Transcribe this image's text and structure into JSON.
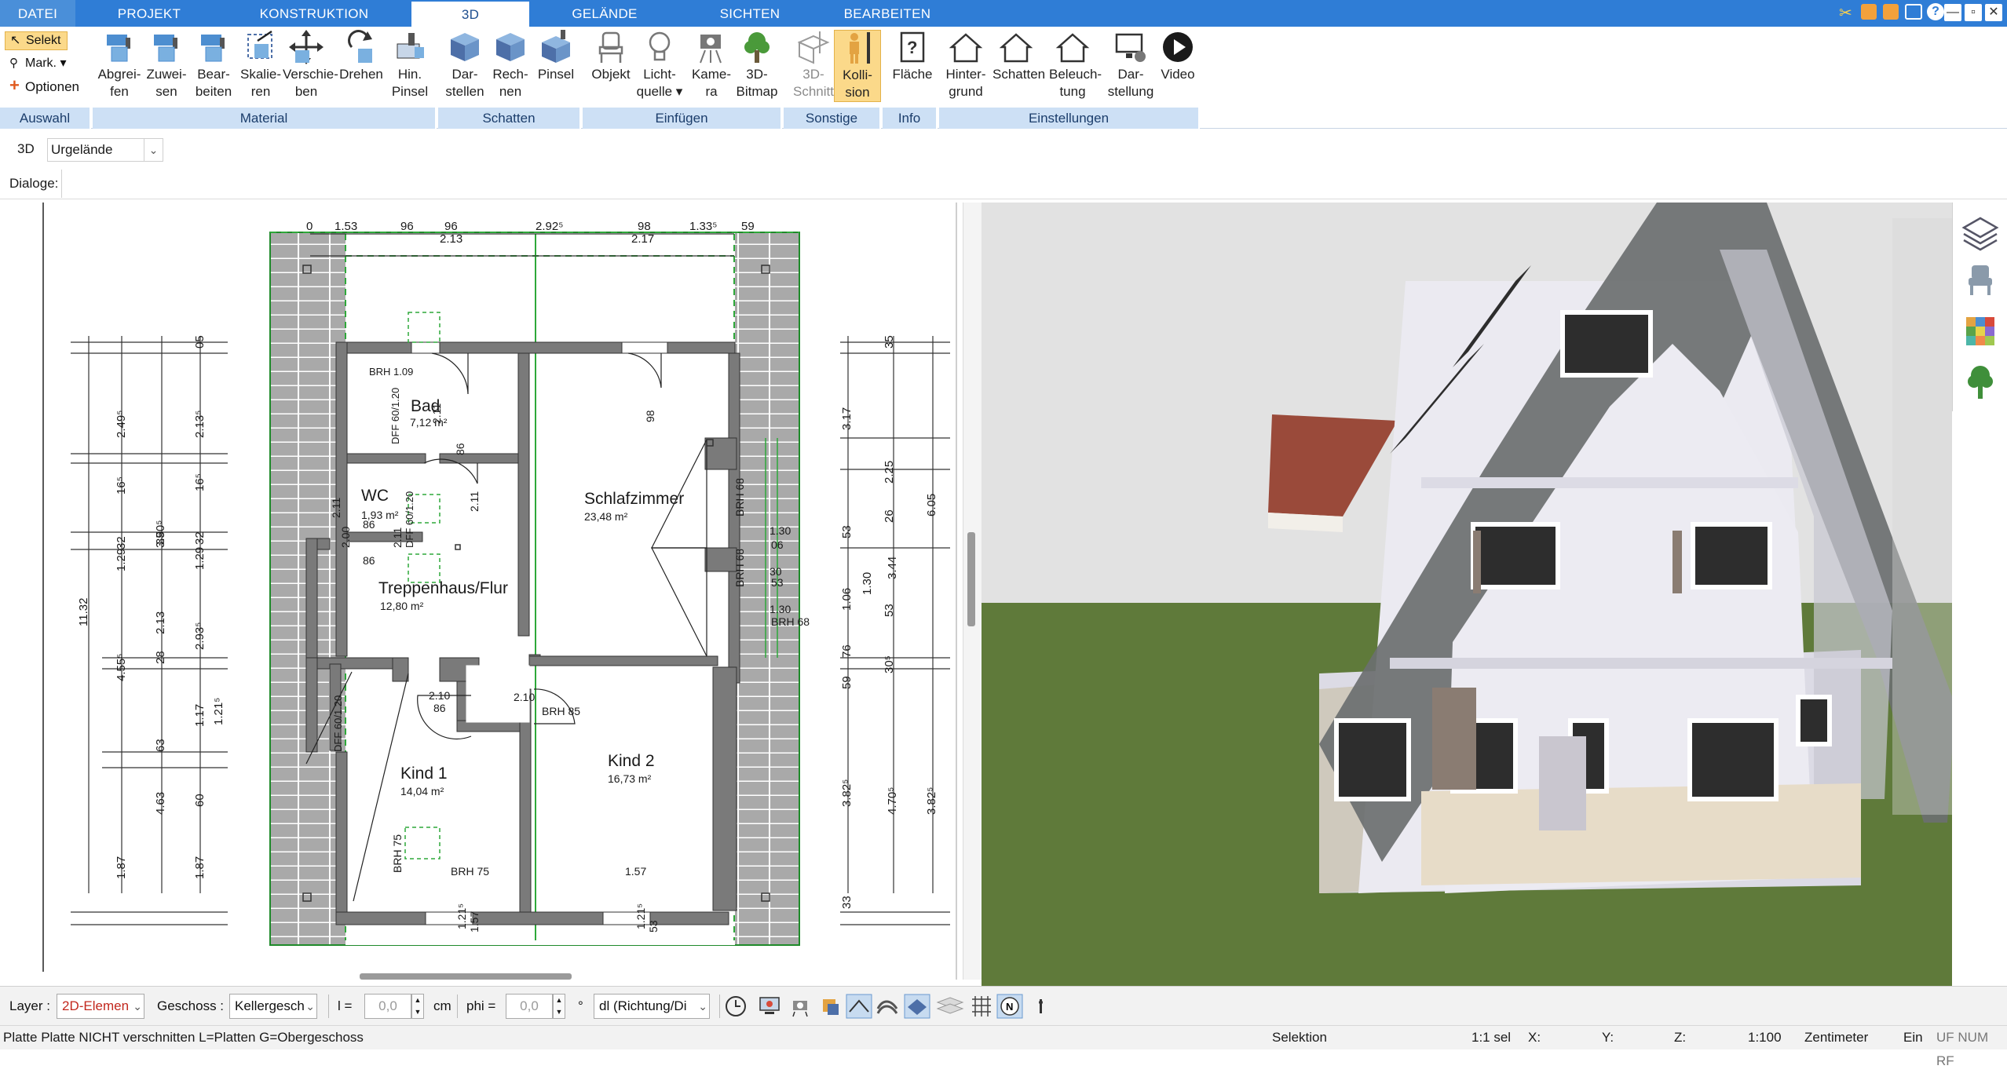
{
  "tabs": [
    "DATEI",
    "PROJEKT",
    "KONSTRUKTION",
    "3D",
    "GELÄNDE",
    "SICHTEN",
    "BEARBEITEN"
  ],
  "window_controls": [
    "—",
    "▫",
    "✕"
  ],
  "selection": {
    "select": "Selekt",
    "mark": "Mark.",
    "options": "Optionen"
  },
  "ribbon": {
    "buttons": [
      {
        "l1": "Abgrei-",
        "l2": "fen",
        "icon": "paint-roller-icon"
      },
      {
        "l1": "Zuwei-",
        "l2": "sen",
        "icon": "paint-roller-icon"
      },
      {
        "l1": "Bear-",
        "l2": "beiten",
        "icon": "paint-roller-icon"
      },
      {
        "l1": "Skalie-",
        "l2": "ren",
        "icon": "scale-icon"
      },
      {
        "l1": "Verschie-",
        "l2": "ben",
        "icon": "move-icon"
      },
      {
        "l1": "Drehen",
        "l2": "",
        "icon": "rotate-icon"
      },
      {
        "l1": "Hin.",
        "l2": "Pinsel",
        "icon": "brush-icon"
      },
      {
        "l1": "Dar-",
        "l2": "stellen",
        "icon": "cube-icon"
      },
      {
        "l1": "Rech-",
        "l2": "nen",
        "icon": "cube-icon"
      },
      {
        "l1": "Pinsel",
        "l2": "",
        "icon": "cube-brush-icon"
      },
      {
        "l1": "Objekt",
        "l2": "",
        "icon": "chair-icon"
      },
      {
        "l1": "Licht-",
        "l2": "quelle ▾",
        "icon": "lightbulb-icon"
      },
      {
        "l1": "Kame-",
        "l2": "ra",
        "icon": "camera-icon"
      },
      {
        "l1": "3D-",
        "l2": "Bitmap",
        "icon": "tree-icon"
      },
      {
        "l1": "3D-",
        "l2": "Schnitt",
        "icon": "section-cube-icon"
      },
      {
        "l1": "Kolli-",
        "l2": "sion",
        "icon": "person-collision-icon"
      },
      {
        "l1": "Fläche",
        "l2": "",
        "icon": "area-info-icon"
      },
      {
        "l1": "Hinter-",
        "l2": "grund",
        "icon": "house-icon"
      },
      {
        "l1": "Schatten",
        "l2": "",
        "icon": "house-icon"
      },
      {
        "l1": "Beleuch-",
        "l2": "tung",
        "icon": "house-icon"
      },
      {
        "l1": "Dar-",
        "l2": "stellung",
        "icon": "monitor-gear-icon"
      },
      {
        "l1": "Video",
        "l2": "",
        "icon": "play-icon"
      }
    ],
    "groups": [
      "Auswahl",
      "Material",
      "Schatten",
      "Einfügen",
      "Sonstige",
      "Info",
      "Einstellungen"
    ]
  },
  "row1": {
    "mode": "3D",
    "dropdown": "Urgelände"
  },
  "row2": {
    "label": "Dialoge:"
  },
  "plan": {
    "rooms": [
      {
        "name": "Bad",
        "area": "7,12 m²"
      },
      {
        "name": "WC",
        "area": "1,93 m²"
      },
      {
        "name": "Schlafzimmer",
        "area": "23,48 m²"
      },
      {
        "name": "Treppenhaus/Flur",
        "area": "12,80 m²"
      },
      {
        "name": "Kind 1",
        "area": "14,04 m²"
      },
      {
        "name": "Kind 2",
        "area": "16,73 m²"
      }
    ],
    "top_dims": [
      "0",
      "1.53",
      "96",
      "96",
      "2.13",
      "2.92⁵",
      "98",
      "2.17",
      "1.33⁵",
      "59"
    ],
    "left_dims_outer": [
      "11.32"
    ],
    "left_dims_mid": [
      "2.49⁵",
      "16⁵",
      "1.29",
      "32",
      "4.55⁵",
      "63",
      "4.63",
      "1.87",
      "3.90⁵",
      "2.13"
    ],
    "left_dims_inner": [
      "05",
      "2.13⁵",
      "16⁵",
      "1.29",
      "32",
      "2.93⁵",
      "28",
      "1.17",
      "1.21⁵",
      "1.87",
      "35",
      "60"
    ],
    "right_dims_outer": [
      "6.05",
      "3.44",
      "4.70⁵",
      "3.82⁵"
    ],
    "right_dims_mid": [
      "35",
      "3.17",
      "2.25",
      "26",
      "53",
      "1.06",
      "53",
      "76",
      "1.30",
      "30⁵",
      "59",
      "3.82⁵",
      "33"
    ],
    "door_labels": [
      "DFF 60/1.20",
      "BRH 1.09",
      "2.11",
      "98",
      "2.11",
      "86",
      "2.11",
      "86",
      "2.11",
      "DFF 60/1.20",
      "2.00",
      "86",
      "2.10",
      "86",
      "2.10",
      "BRH 85",
      "DFF 60/1.20",
      "BRH 75",
      "BRH 75",
      "1.57",
      "1.21⁵",
      "1.57",
      "1.21⁵",
      "53",
      "1.30",
      "06",
      "30",
      "53",
      "1.30",
      "BRH 68",
      "BRH 68",
      "BRH 68"
    ]
  },
  "bottombar": {
    "layer_label": "Layer :",
    "layer_value": "2D-Elemen",
    "floor_label": "Geschoss :",
    "floor_value": "Kellergesch",
    "l_label": "l =",
    "l_value": "0,0",
    "l_unit": "cm",
    "phi_label": "phi =",
    "phi_value": "0,0",
    "phi_unit": "°",
    "dl_value": "dl (Richtung/Di"
  },
  "status": {
    "hint": "Platte Platte NICHT verschnitten L=Platten G=Obergeschoss",
    "mode": "Selektion",
    "sel": "1:1 sel",
    "x": "X:",
    "y": "Y:",
    "z": "Z:",
    "scale": "1:100",
    "unit": "Zentimeter",
    "ein": "Ein",
    "flags": "UF NUM RF"
  },
  "colors": {
    "tabbar": "#2f7dd6",
    "group_bar": "#cde0f5",
    "highlight": "#fbd98a",
    "sky": "#e2e2e2",
    "grass": "#5f7a3a",
    "roof": "#6b6f70",
    "wall": "#ecebf2"
  }
}
